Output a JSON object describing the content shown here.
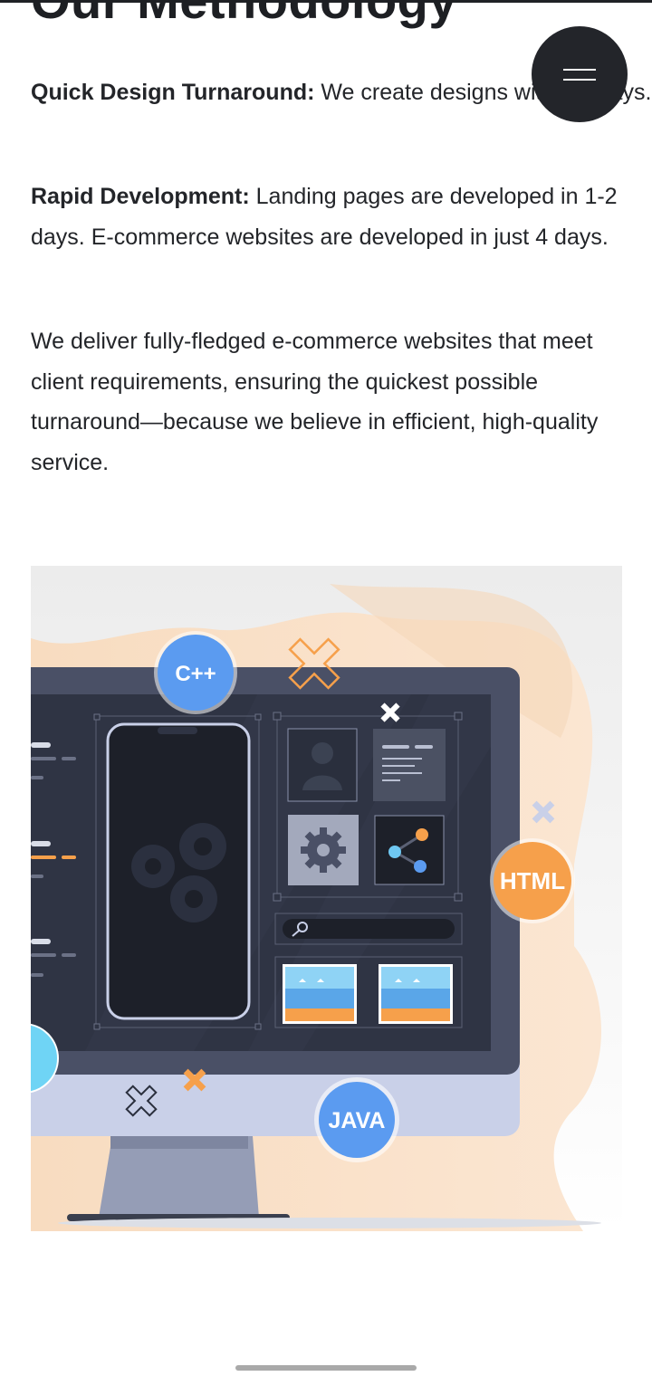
{
  "page": {
    "heading": "Our Methodology",
    "menu_button": {
      "icon": "hamburger-menu-icon"
    }
  },
  "content": {
    "p1": {
      "label": "Quick Design Turnaround:",
      "text": " We create designs within 3 days."
    },
    "p2": {
      "label": "Rapid Development:",
      "text": " Landing pages are developed in 1-2 days. E-commerce websites are developed in just 4 days."
    },
    "p3": {
      "text": "We deliver fully-fledged e-commerce websites that meet client requirements, ensuring the quickest possible turnaround—because we believe in efficient, high-quality service."
    }
  },
  "illustration": {
    "badges": {
      "cpp": "C++",
      "html": "HTML",
      "java": "JAVA"
    },
    "colors": {
      "blob": "#f8dfc4",
      "monitor_frame": "#c9d0e8",
      "screen": "#2f3444",
      "accent_orange": "#f6a04b",
      "accent_blue": "#5b9bf0"
    }
  }
}
